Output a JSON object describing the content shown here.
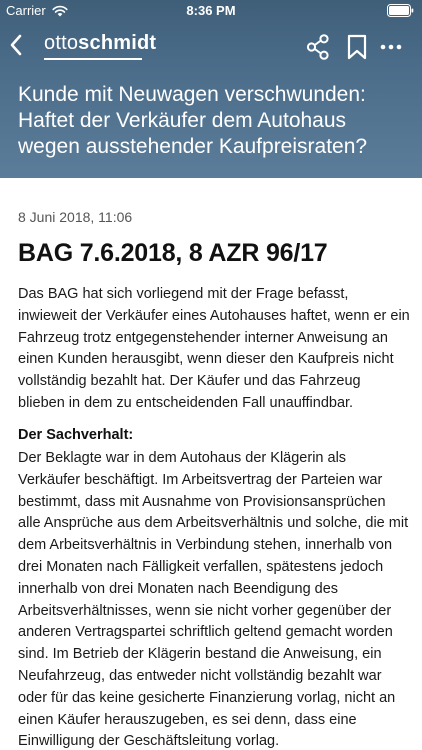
{
  "status_bar": {
    "carrier": "Carrier",
    "time": "8:36 PM"
  },
  "nav": {
    "logo_light": "otto",
    "logo_bold": "schmidt",
    "icons": [
      "back-chevron-icon",
      "share-icon",
      "bookmark-icon",
      "more-icon"
    ]
  },
  "article": {
    "headline": "Kunde mit Neuwagen verschwunden: Haftet der Verkäufer dem Autohaus wegen ausstehender Kaufpreisraten?",
    "date": "8 Juni 2018, 11:06",
    "case_title": "BAG 7.6.2018, 8 AZR 96/17",
    "intro": "Das BAG hat sich vorliegend mit der Frage befasst, inwieweit der Verkäufer eines Autohauses haftet, wenn er ein Fahrzeug trotz entgegenstehender interner Anweisung an einen Kunden herausgibt, wenn dieser den Kaufpreis nicht vollständig bezahlt hat. Der Käufer und das Fahrzeug blieben in dem zu entscheidenden Fall unauffindbar.",
    "section_heading": "Der Sachverhalt:",
    "facts": "Der Beklagte war in dem Autohaus der Klägerin als Verkäufer beschäftigt. Im Arbeitsvertrag der Parteien war bestimmt, dass mit Ausnahme von Provisionsansprüchen alle Ansprüche aus dem Arbeitsverhältnis und solche, die mit dem Arbeitsverhältnis in Verbindung stehen, innerhalb von drei Monaten nach Fälligkeit verfallen, spätestens jedoch innerhalb von drei Monaten nach Beendigung des Arbeitsverhältnisses, wenn sie nicht vorher gegenüber der anderen Vertragspartei schriftlich geltend gemacht worden sind. Im Betrieb der Klägerin bestand die Anweisung, ein Neufahrzeug, das entweder nicht vollständig bezahlt war oder für das keine gesicherte Finanzierung vorlag, nicht an einen Käufer herauszugeben, es sei denn, dass eine Einwilligung der Geschäftsleitung vorlag."
  },
  "colors": {
    "header_top": "#3f5e78",
    "header_bottom": "#5b7d9a",
    "text": "#1a1a1a",
    "date_text": "#555555"
  }
}
